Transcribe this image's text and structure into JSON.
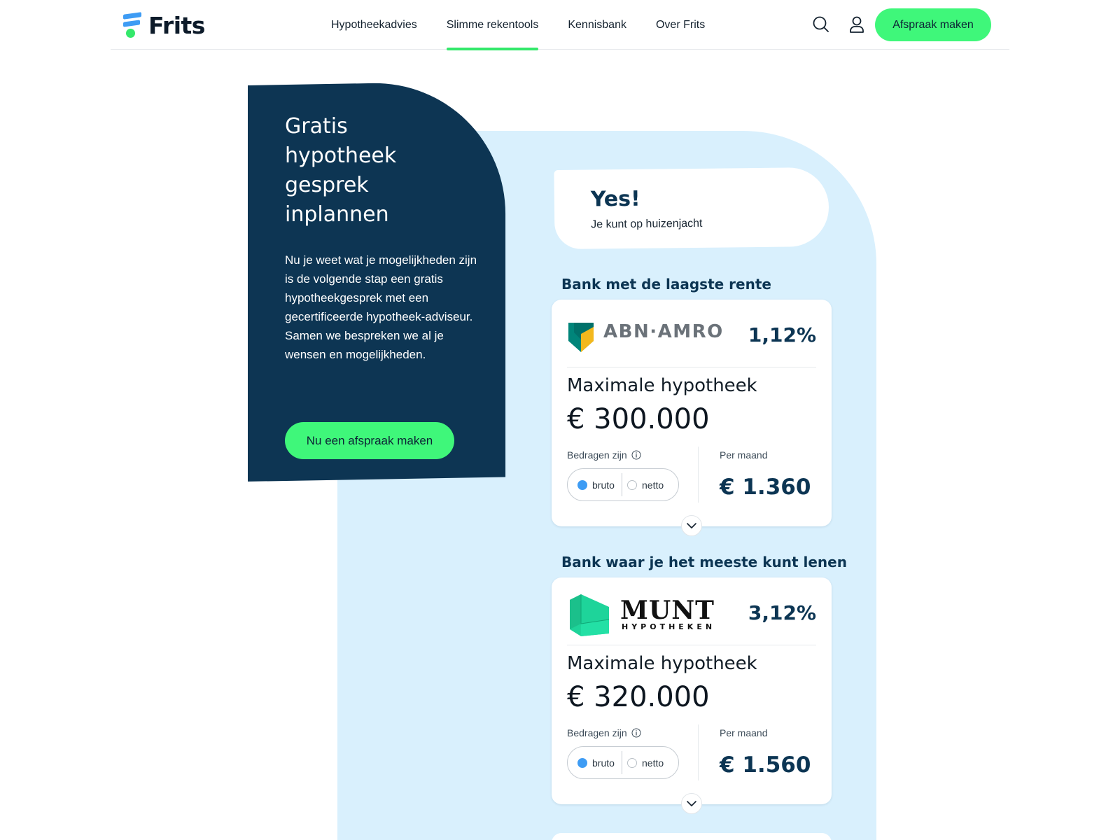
{
  "header": {
    "logo_text": "Frits",
    "nav": [
      {
        "label": "Hypotheekadvies"
      },
      {
        "label": "Slimme rekentools",
        "active": true
      },
      {
        "label": "Kennisbank"
      },
      {
        "label": "Over Frits"
      }
    ],
    "search_icon": "search-icon",
    "account_icon": "user-icon",
    "cta_label": "Afspraak maken"
  },
  "promo": {
    "title": "Gratis hypotheek gesprek inplannen",
    "body": "Nu je weet wat je mogelijkheden zijn is de volgende stap een gratis hypotheekgesprek met een gecertificeerde hypotheek-adviseur. Samen we bespreken we al je wensen en mogelijkheden.",
    "cta_label": "Nu een afspraak maken"
  },
  "result": {
    "title": "Yes!",
    "subtitle": "Je kunt op huizenjacht"
  },
  "banks": [
    {
      "heading": "Bank met de laagste rente",
      "bank_name": "ABN·AMRO",
      "rate": "1,12%",
      "max_label": "Maximale hypotheek",
      "max_value": "€ 300.000",
      "amounts_label": "Bedragen zijn",
      "option_bruto": "bruto",
      "option_netto": "netto",
      "selected": "bruto",
      "per_month_label": "Per maand",
      "per_month_value": "€ 1.360"
    },
    {
      "heading": "Bank waar je het meeste kunt lenen",
      "bank_name": "MUNT",
      "bank_subname": "HYPOTHEKEN",
      "rate": "3,12%",
      "max_label": "Maximale hypotheek",
      "max_value": "€ 320.000",
      "amounts_label": "Bedragen zijn",
      "option_bruto": "bruto",
      "option_netto": "netto",
      "selected": "bruto",
      "per_month_label": "Per maand",
      "per_month_value": "€ 1.560"
    }
  ],
  "colors": {
    "navy": "#0d3553",
    "accent_green": "#3ff77a",
    "light_blue": "#d9f0fd",
    "radio_blue": "#3e9cf4",
    "munt_green": "#1ed49a"
  }
}
